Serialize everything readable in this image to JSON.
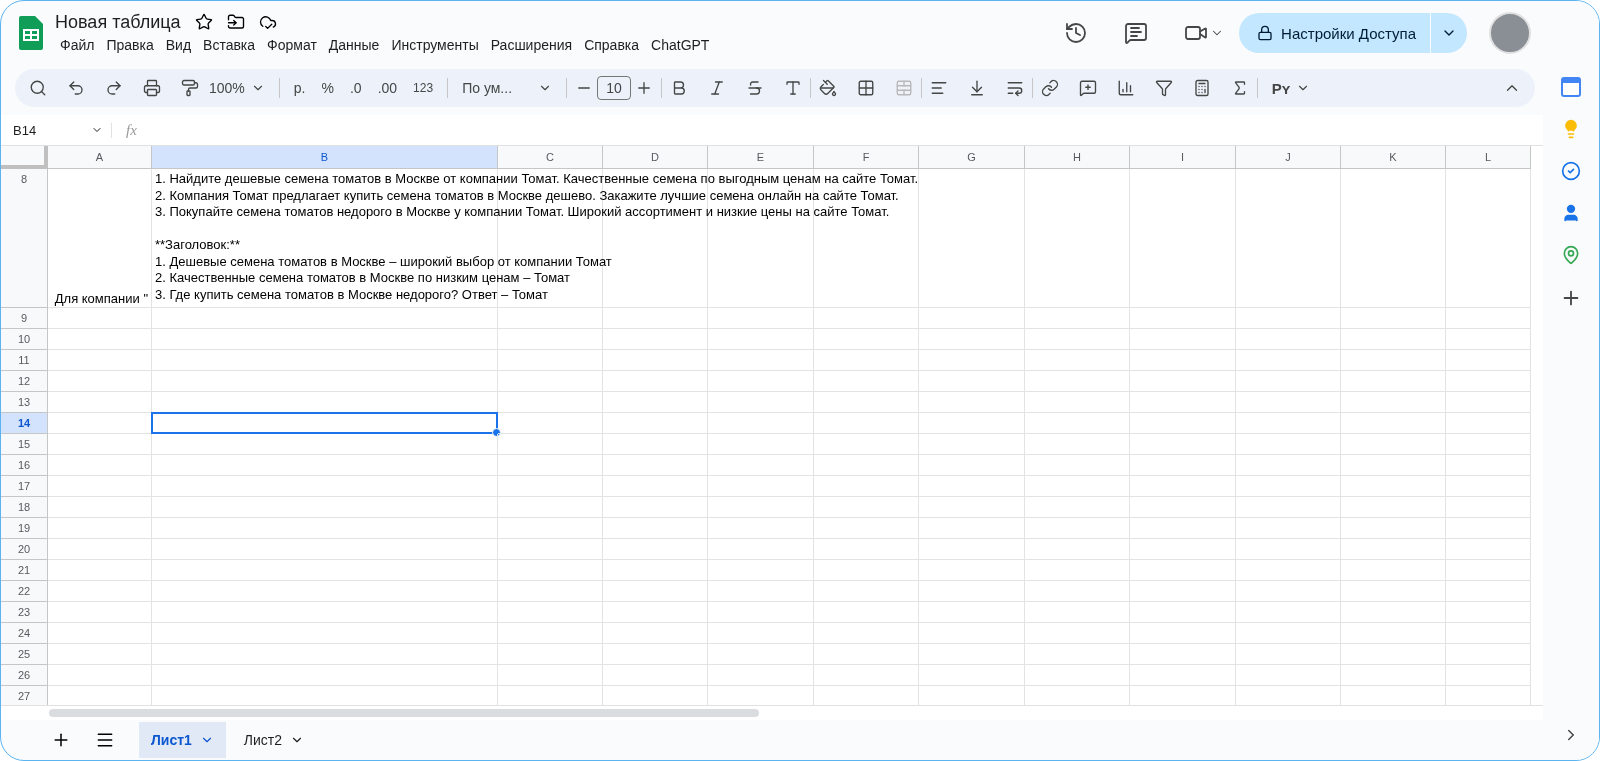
{
  "doc": {
    "title": "Новая таблица"
  },
  "menu": [
    "Файл",
    "Правка",
    "Вид",
    "Вставка",
    "Формат",
    "Данные",
    "Инструменты",
    "Расширения",
    "Справка",
    "ChatGPT"
  ],
  "share_button": "Настройки Доступа",
  "toolbar": {
    "zoom": "100%",
    "currency": "р.",
    "percent": "%",
    "decrease_decimals": ".0",
    "increase_decimals": ".00",
    "number_format": "123",
    "font": "По ум...",
    "font_size": "10",
    "addon": "Pʏ"
  },
  "name_box": "B14",
  "formula_label": "fx",
  "columns": [
    {
      "label": "A",
      "selected": false
    },
    {
      "label": "B",
      "selected": true
    },
    {
      "label": "C",
      "selected": false
    },
    {
      "label": "D",
      "selected": false
    },
    {
      "label": "E",
      "selected": false
    },
    {
      "label": "F",
      "selected": false
    },
    {
      "label": "G",
      "selected": false
    },
    {
      "label": "H",
      "selected": false
    },
    {
      "label": "I",
      "selected": false
    },
    {
      "label": "J",
      "selected": false
    },
    {
      "label": "K",
      "selected": false
    },
    {
      "label": "L",
      "selected": false
    }
  ],
  "rows": [
    {
      "number": "8",
      "selected": false,
      "cell_a": "Для компании \"",
      "cell_b": [
        [
          "1. Найдите дешевые семена томатов в Москве от компании Томат. Качественные семена по выгодным ценам на сайте Томат.",
          "2. Компания Томат предлагает купить семена томатов в Москве дешево. Закажите лучшие семена онлайн на сайте Томат.",
          "3. Покупайте семена томатов недорого в Москве у компании Томат. Широкий ассортимент и низкие цены на сайте Томат."
        ],
        [
          "**Заголовок:**",
          "1. Дешевые семена томатов в Москве – широкий выбор от компании Томат",
          "2. Качественные семена томатов в Москве по низким ценам – Томат",
          "3. Где купить семена томатов в Москве недорого? Ответ – Томат"
        ]
      ]
    },
    {
      "number": "9",
      "selected": false
    },
    {
      "number": "10",
      "selected": false
    },
    {
      "number": "11",
      "selected": false
    },
    {
      "number": "12",
      "selected": false
    },
    {
      "number": "13",
      "selected": false
    },
    {
      "number": "14",
      "selected": true
    },
    {
      "number": "15",
      "selected": false
    },
    {
      "number": "16",
      "selected": false
    },
    {
      "number": "17",
      "selected": false
    },
    {
      "number": "18",
      "selected": false
    },
    {
      "number": "19",
      "selected": false
    },
    {
      "number": "20",
      "selected": false
    },
    {
      "number": "21",
      "selected": false
    },
    {
      "number": "22",
      "selected": false
    },
    {
      "number": "23",
      "selected": false
    },
    {
      "number": "24",
      "selected": false
    },
    {
      "number": "25",
      "selected": false
    },
    {
      "number": "26",
      "selected": false
    },
    {
      "number": "27",
      "selected": false
    }
  ],
  "sheets": [
    {
      "label": "Лист1",
      "selected": true
    },
    {
      "label": "Лист2",
      "selected": false
    }
  ]
}
